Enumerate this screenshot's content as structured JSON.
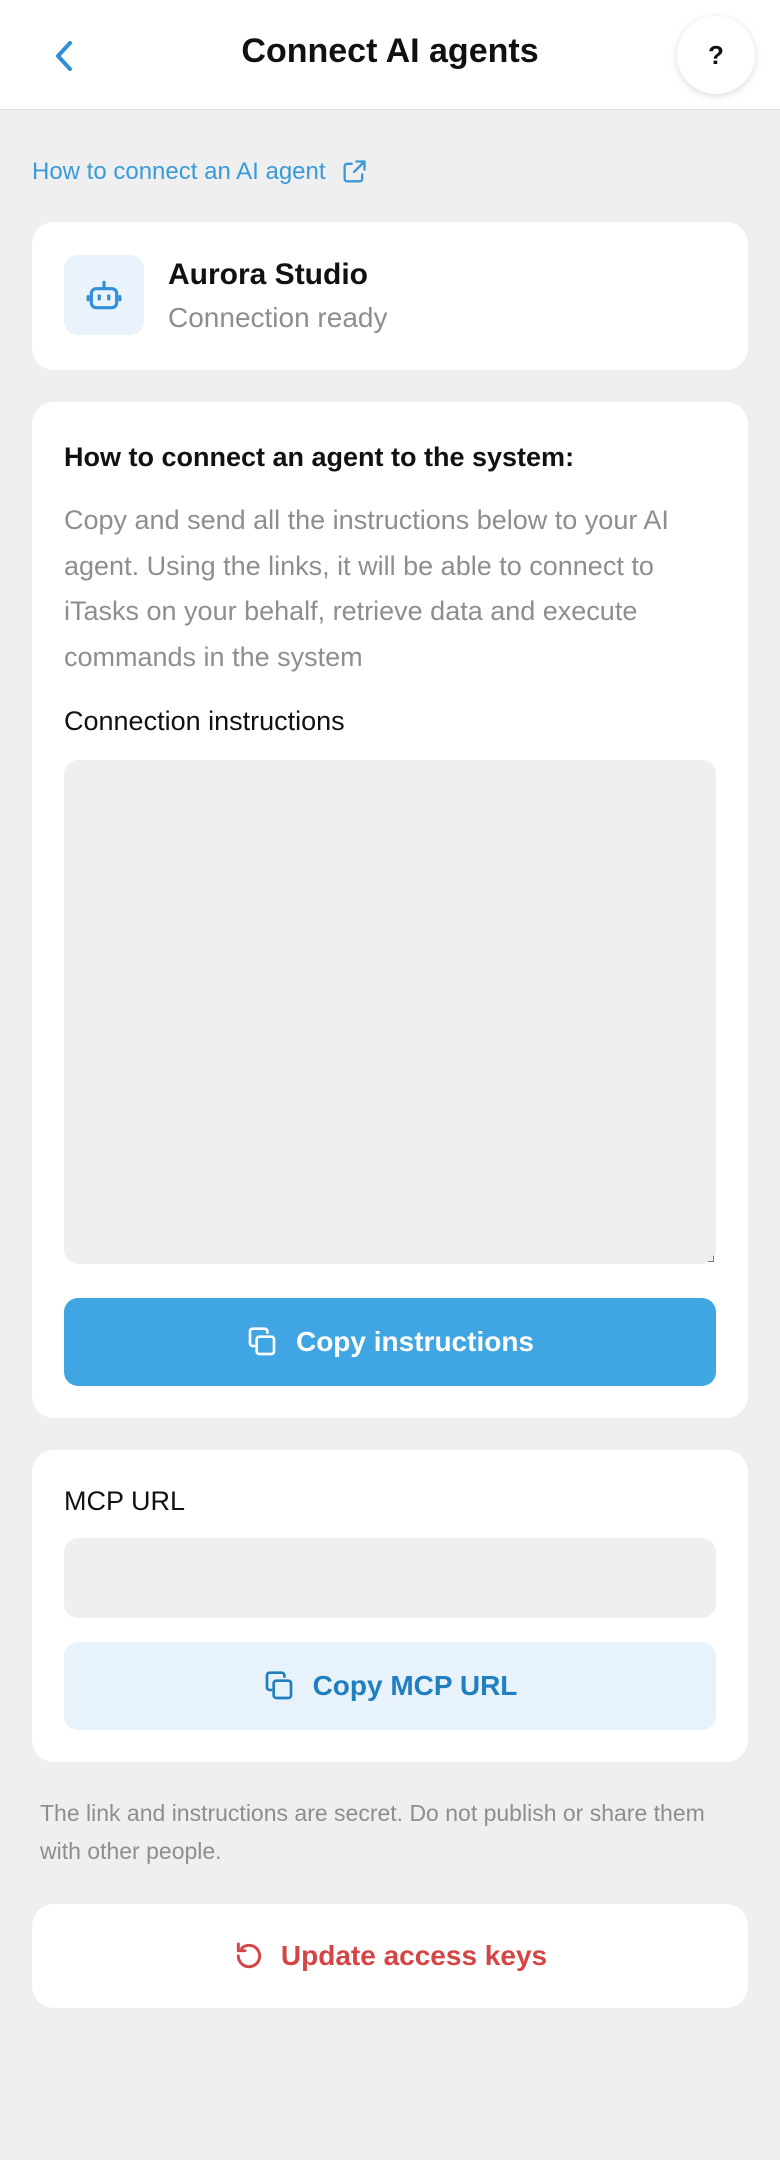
{
  "header": {
    "title": "Connect AI agents",
    "back_icon": "chevron-left-icon",
    "help_label": "?"
  },
  "guide_link": {
    "label": "How to connect an AI agent",
    "icon": "external-link-icon",
    "color": "#3a9ad9"
  },
  "agent": {
    "icon": "robot-icon",
    "name": "Aurora Studio",
    "status": "Connection ready"
  },
  "instructions": {
    "heading": "How to connect an agent to the system:",
    "description": "Copy and send all the instructions below to your AI agent. Using the links, it will be able to connect to iTasks on your behalf, retrieve data and execute commands in the system",
    "label": "Connection instructions",
    "value": "",
    "copy_button": {
      "label": "Copy instructions",
      "icon": "copy-icon",
      "color": "#40a6e3"
    }
  },
  "mcp": {
    "label": "MCP URL",
    "value": "",
    "copy_button": {
      "label": "Copy MCP URL",
      "icon": "copy-icon",
      "color": "#1f7fc0"
    }
  },
  "secret_note": "The link and instructions are secret. Do not publish or share them with other people.",
  "update_keys": {
    "label": "Update access keys",
    "icon": "refresh-icon",
    "color": "#d64545"
  }
}
